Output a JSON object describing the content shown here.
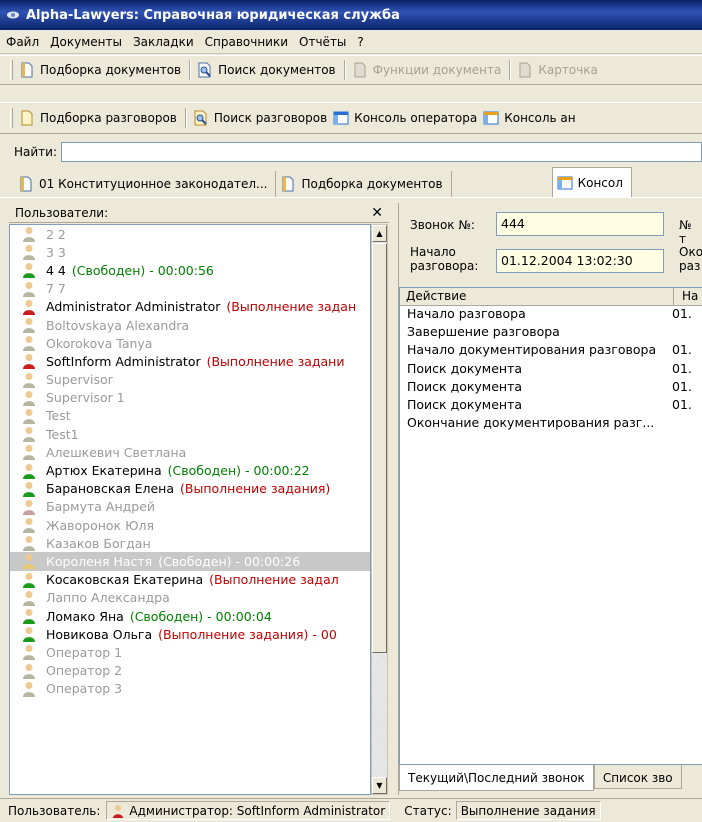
{
  "window": {
    "title": "Alpha-Lawyers: Справочная юридическая служба"
  },
  "menu": [
    "Файл",
    "Документы",
    "Закладки",
    "Справочники",
    "Отчёты",
    "?"
  ],
  "toolbar1": [
    {
      "label": "Подборка документов",
      "icon": "document-icon",
      "disabled": false
    },
    {
      "label": "Поиск документов",
      "icon": "search-document-icon",
      "disabled": false
    },
    {
      "label": "Функции документа",
      "icon": "document-functions-icon",
      "disabled": true
    },
    {
      "label": "Карточка",
      "icon": "card-icon",
      "disabled": true
    }
  ],
  "toolbar2": [
    {
      "label": "Подборка разговоров",
      "icon": "conversation-icon"
    },
    {
      "label": "Поиск разговоров",
      "icon": "search-conversation-icon"
    },
    {
      "label": "Консоль оператора",
      "icon": "operator-console-icon"
    },
    {
      "label": "Консоль ан",
      "icon": "analyst-console-icon"
    }
  ],
  "find": {
    "label": "Найти:",
    "value": ""
  },
  "doc_tabs": [
    {
      "label": "01 Конституционное законодател...",
      "active": false
    },
    {
      "label": "Подборка документов",
      "active": false
    },
    {
      "label": "Консол",
      "active": true
    }
  ],
  "users_panel": {
    "title": "Пользователи:",
    "close": "✕",
    "users": [
      {
        "name": "2 2",
        "status": "",
        "state": "offline",
        "icon_color": "#b5b5a0"
      },
      {
        "name": "3 3",
        "status": "",
        "state": "offline",
        "icon_color": "#b5b5a0"
      },
      {
        "name": "4 4",
        "status": "(Свободен) - 00:00:56",
        "state": "free",
        "icon_color": "#1c9a1c"
      },
      {
        "name": "7 7",
        "status": "",
        "state": "offline",
        "icon_color": "#b5b5a0"
      },
      {
        "name": "Administrator Administrator",
        "status": "(Выполнение задан",
        "state": "busy",
        "icon_color": "#c81e1e"
      },
      {
        "name": "Boltovskaya Alexandra",
        "status": "",
        "state": "offline",
        "icon_color": "#b5b5a0"
      },
      {
        "name": "Okorokova Tanya",
        "status": "",
        "state": "offline",
        "icon_color": "#b5b5a0"
      },
      {
        "name": "SoftInform Administrator",
        "status": "(Выполнение задани",
        "state": "busy",
        "icon_color": "#c81e1e"
      },
      {
        "name": "Supervisor",
        "status": "",
        "state": "offline",
        "icon_color": "#b5b5a0"
      },
      {
        "name": "Supervisor 1",
        "status": "",
        "state": "offline",
        "icon_color": "#b5b5a0"
      },
      {
        "name": "Test",
        "status": "",
        "state": "offline",
        "icon_color": "#b5b5a0"
      },
      {
        "name": "Test1",
        "status": "",
        "state": "offline",
        "icon_color": "#b5b5a0"
      },
      {
        "name": "Алешкевич Светлана",
        "status": "",
        "state": "offline",
        "icon_color": "#b5b5a0"
      },
      {
        "name": "Артюх Екатерина",
        "status": "(Свободен) - 00:00:22",
        "state": "free",
        "icon_color": "#1c9a1c"
      },
      {
        "name": "Барановская Елена",
        "status": "(Выполнение задания)",
        "state": "busy",
        "icon_color": "#1c9a1c"
      },
      {
        "name": "Бармута Андрей",
        "status": "",
        "state": "offline",
        "icon_color": "#c8a0a0"
      },
      {
        "name": "Жаворонок Юля",
        "status": "",
        "state": "offline",
        "icon_color": "#b5b5a0"
      },
      {
        "name": "Казаков Богдан",
        "status": "",
        "state": "offline",
        "icon_color": "#b5b5a0"
      },
      {
        "name": "Короленя Настя",
        "status": "(Свободен) - 00:00:26",
        "state": "selected",
        "icon_color": "#e8c870"
      },
      {
        "name": "Косаковская Екатерина",
        "status": "(Выполнение задал",
        "state": "busy",
        "icon_color": "#1c9a1c"
      },
      {
        "name": "Лаппо Александра",
        "status": "",
        "state": "offline",
        "icon_color": "#b5b5a0"
      },
      {
        "name": "Ломако Яна",
        "status": "(Свободен) - 00:00:04",
        "state": "free",
        "icon_color": "#1c9a1c"
      },
      {
        "name": "Новикова Ольга",
        "status": "(Выполнение задания) - 00",
        "state": "busy",
        "icon_color": "#1c9a1c"
      },
      {
        "name": "Оператор 1",
        "status": "",
        "state": "offline",
        "icon_color": "#b5b5a0"
      },
      {
        "name": "Оператор 2",
        "status": "",
        "state": "offline",
        "icon_color": "#b5b5a0"
      },
      {
        "name": "Оператор 3",
        "status": "",
        "state": "offline",
        "icon_color": "#b5b5a0"
      }
    ]
  },
  "call_panel": {
    "call_no_label": "Звонок №:",
    "call_no_value": "444",
    "phone_label_cut": "№ т",
    "start_label": "Начало\nразговора:",
    "start_value": "01.12.2004 13:02:30",
    "end_label_cut": "Око\nраз",
    "columns": [
      "Действие",
      "На"
    ],
    "actions": [
      {
        "action": "Начало разговора",
        "time": "01."
      },
      {
        "action": "Завершение разговора",
        "time": ""
      },
      {
        "action": "Начало документирования разговора",
        "time": "01."
      },
      {
        "action": "Поиск документа",
        "time": "01."
      },
      {
        "action": "Поиск документа",
        "time": "01."
      },
      {
        "action": "Поиск документа",
        "time": "01."
      },
      {
        "action": "Окончание документирования разг...",
        "time": ""
      }
    ],
    "bottom_tabs": [
      "Текущий\\Последний звонок",
      "Список зво"
    ]
  },
  "statusbar": {
    "user_label": "Пользователь:",
    "user_value": "Администратор: SoftInform Administrator",
    "status_label": "Статус:",
    "status_value": "Выполнение задания"
  },
  "colors": {
    "titlebar": "#0a246a",
    "free": "#008000",
    "busy": "#c00000",
    "field_bg": "#fffde2"
  }
}
